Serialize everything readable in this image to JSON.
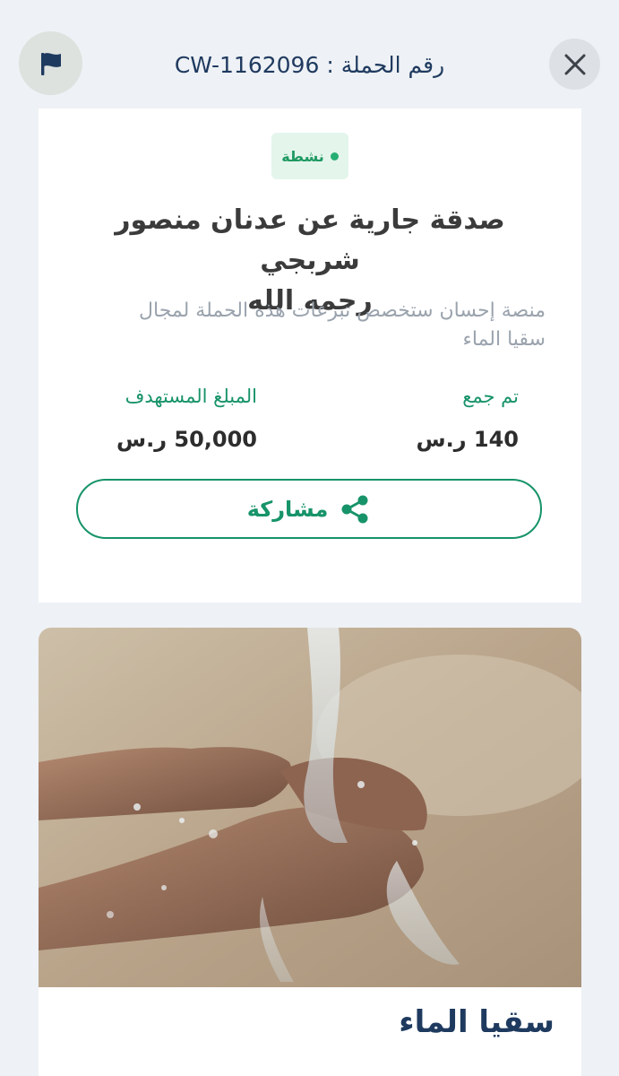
{
  "header": {
    "campaign_number_label": "رقم الحملة :",
    "campaign_number": "CW-1162096"
  },
  "campaign": {
    "status": "نشطة",
    "title_line1": "صدقة جارية عن عدنان منصور شربجي",
    "title_line2": "رحمه الله",
    "description_line1": "منصة إحسان ستخصص تبرعات هذه الحملة لمجال",
    "description_line2": "سقيا الماء",
    "raised": {
      "label": "تم جمع",
      "value": "140 ر.س"
    },
    "target": {
      "label": "المبلغ المستهدف",
      "value": "50,000 ر.س"
    },
    "share_label": "مشاركة"
  },
  "category_card": {
    "title": "سقيا الماء"
  },
  "colors": {
    "accent_green": "#17936a",
    "navy": "#1f3a5f",
    "background": "#eef1f5"
  },
  "icons": {
    "flag": "flag-icon",
    "close": "close-icon",
    "share": "share-icon"
  }
}
